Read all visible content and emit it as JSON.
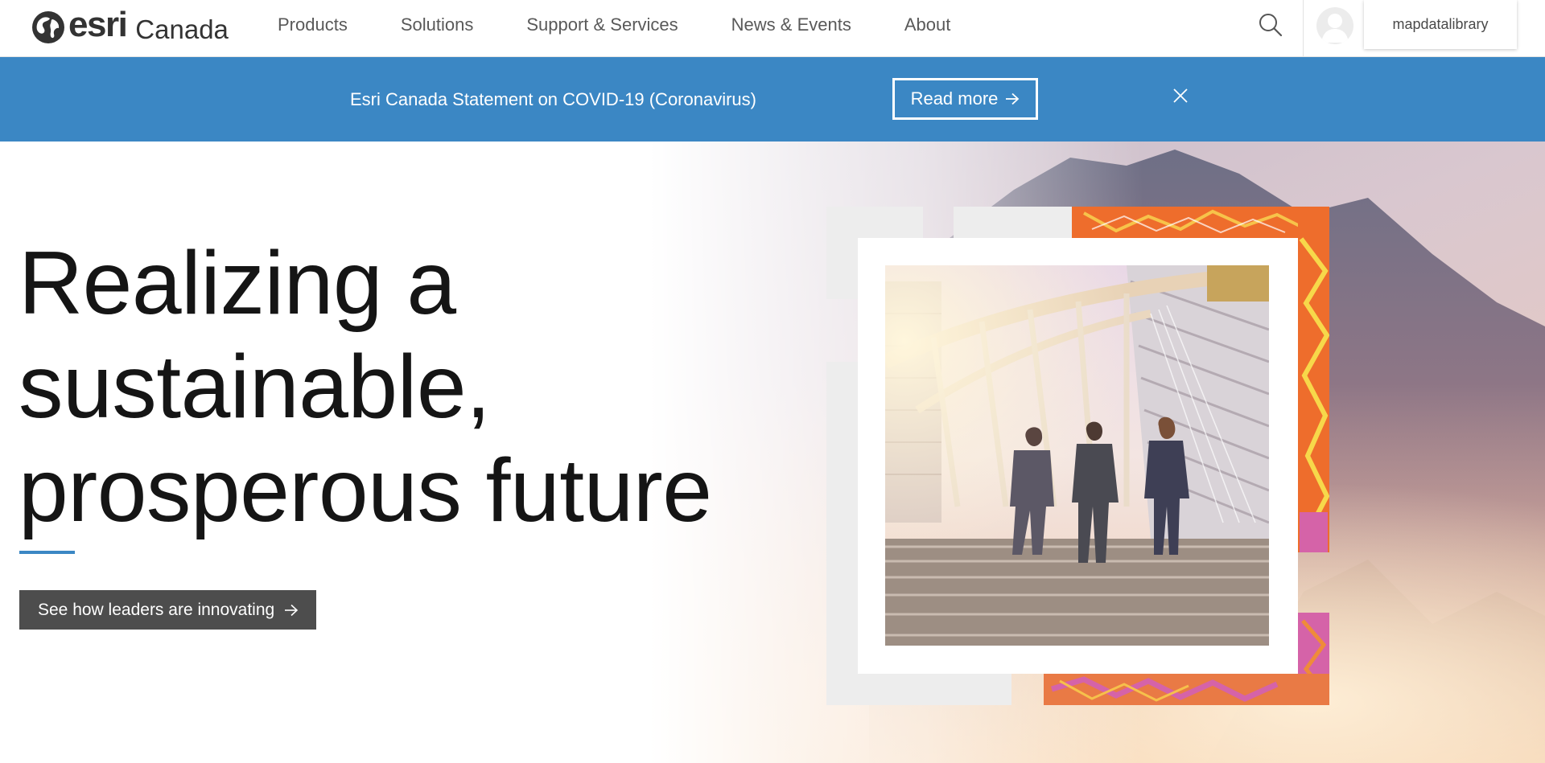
{
  "brand": {
    "wordmark": "esri",
    "region": "Canada"
  },
  "nav": {
    "items": [
      {
        "label": "Products"
      },
      {
        "label": "Solutions"
      },
      {
        "label": "Support & Services"
      },
      {
        "label": "News & Events"
      },
      {
        "label": "About"
      }
    ],
    "search_icon": "search-icon",
    "username": "mapdatalibrary"
  },
  "banner": {
    "text": "Esri Canada Statement on COVID-19 (Coronavirus)",
    "button_label": "Read more",
    "close_icon": "close-icon",
    "color": "#3b87c4"
  },
  "hero": {
    "title_lines": [
      "Realizing a",
      "sustainable,",
      "prosperous future"
    ],
    "cta_label": "See how leaders are innovating",
    "accent_color": "#3b87c4",
    "cta_color": "#4d4d4d"
  }
}
